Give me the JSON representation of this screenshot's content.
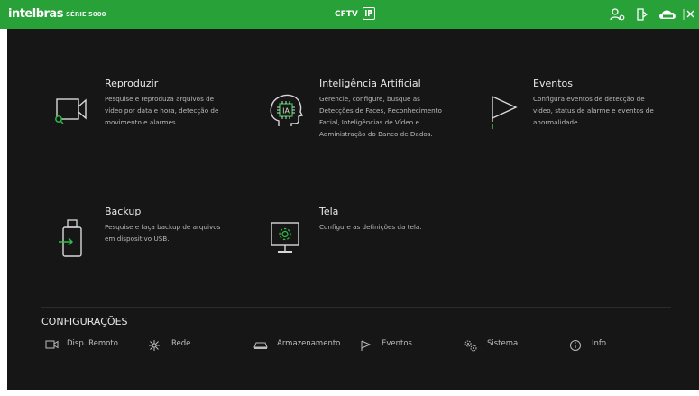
{
  "header": {
    "logo_text": "intelbras",
    "series_text": "SÉRIE 5000",
    "brand_text": "CFTV",
    "icons": [
      "user-settings-icon",
      "logout-icon",
      "cloud-icon",
      "close-icon"
    ],
    "cloud_label": "Cloud"
  },
  "modules": [
    {
      "title": "Reproduzir",
      "description": "Pesquise e reproduza arquivos de\nvídeo por data e hora, detecção de\nmovimento e alarmes.",
      "icon": "playback-camera-search-icon"
    },
    {
      "title": "Inteligência Artificial",
      "description": "Gerencie, configure, busque as\nDetecções de Faces, Reconhecimento\n Facial, Inteligências de Vídeo e\nAdministração do Banco de Dados.",
      "icon": "ai-head-icon",
      "icon_label": "IA"
    },
    {
      "title": "Eventos",
      "description": "Configura eventos de detecção de\nvídeo, status de alarme e eventos de\nanormalidade.",
      "icon": "event-flag-icon"
    },
    {
      "title": "Backup",
      "description": "Pesquise e faça backup de arquivos\nem dispositivo USB.",
      "icon": "usb-backup-icon"
    },
    {
      "title": "Tela",
      "description": "Configure as definições da tela.",
      "icon": "monitor-settings-icon"
    }
  ],
  "config": {
    "title": "CONFIGURAÇÕES",
    "items": [
      {
        "label": "Disp. Remoto",
        "icon": "camera-icon"
      },
      {
        "label": "Rede",
        "icon": "network-icon"
      },
      {
        "label": "Armazenamento",
        "icon": "hdd-icon"
      },
      {
        "label": "Eventos",
        "icon": "flag-icon"
      },
      {
        "label": "Sistema",
        "icon": "gears-icon"
      },
      {
        "label": "Info",
        "icon": "info-icon"
      }
    ]
  },
  "colors": {
    "header_green": "#27a138",
    "background": "#161616",
    "accent_green": "#2fbf48"
  }
}
